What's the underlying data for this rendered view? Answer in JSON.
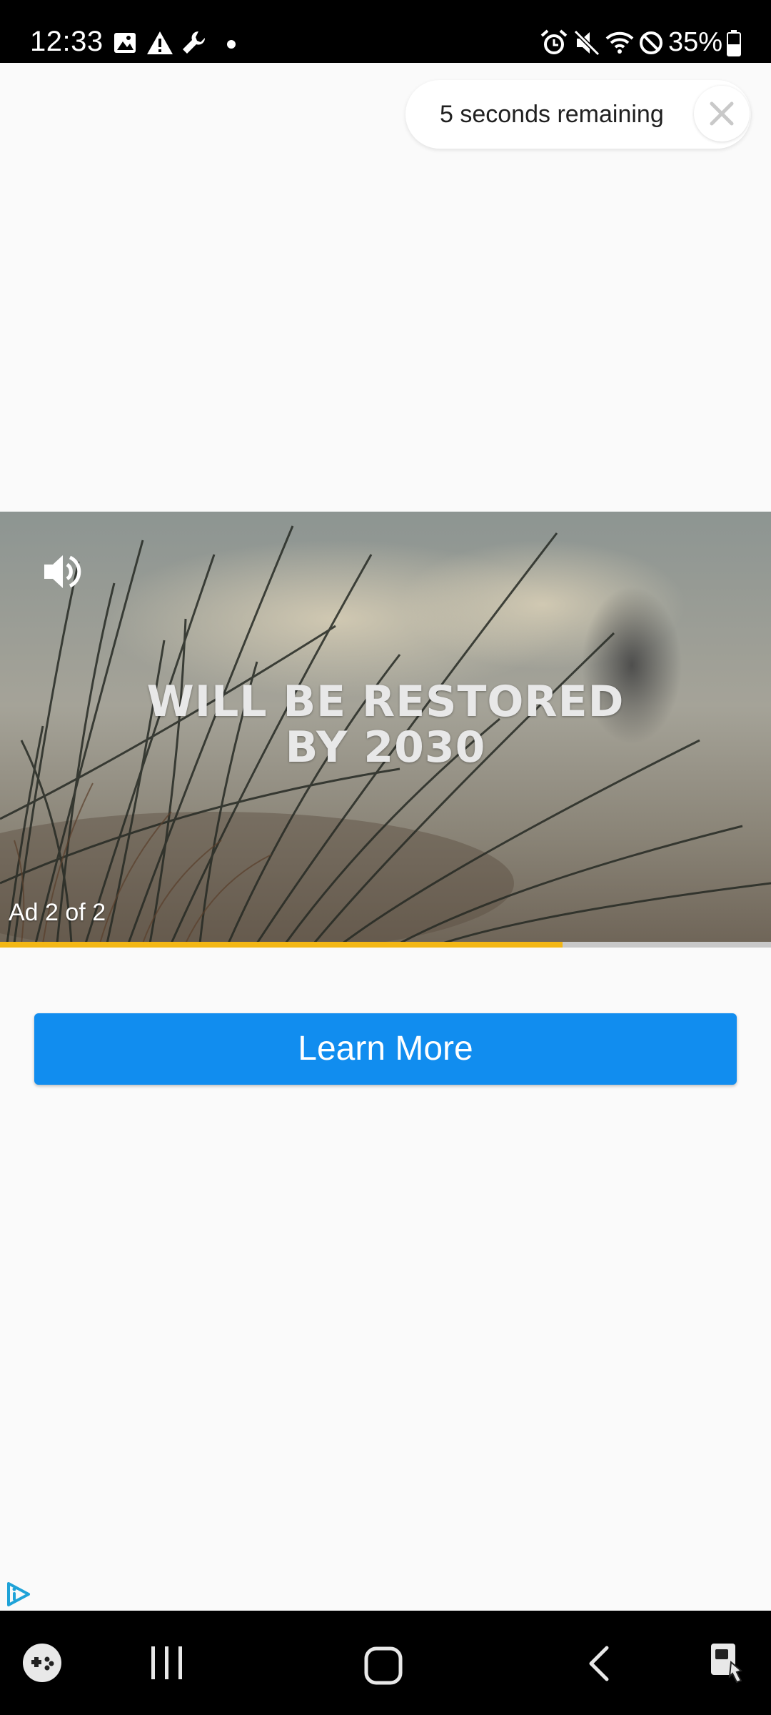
{
  "status_bar": {
    "time": "12:33",
    "battery_percent": "35%",
    "icons": [
      "gallery-icon",
      "warning-icon",
      "wrench-icon",
      "dot-icon",
      "alarm-icon",
      "mute-icon",
      "wifi-icon",
      "do-not-disturb-icon",
      "battery-icon"
    ]
  },
  "ad": {
    "countdown_text": "5 seconds remaining",
    "close_icon": "close-icon",
    "video_headline_line1": "WILL BE RESTORED",
    "video_headline_line2": "BY 2030",
    "counter_text": "Ad 2 of 2",
    "sound_icon": "volume-icon",
    "progress_fraction": 0.73,
    "progress_color": "#f3b715",
    "cta_label": "Learn More",
    "cta_color": "#118def",
    "adchoices_icon": "adchoices-icon"
  },
  "nav_bar": {
    "icons": [
      "game-launcher-icon",
      "recent-apps-icon",
      "home-icon",
      "back-icon",
      "accessibility-icon"
    ]
  }
}
